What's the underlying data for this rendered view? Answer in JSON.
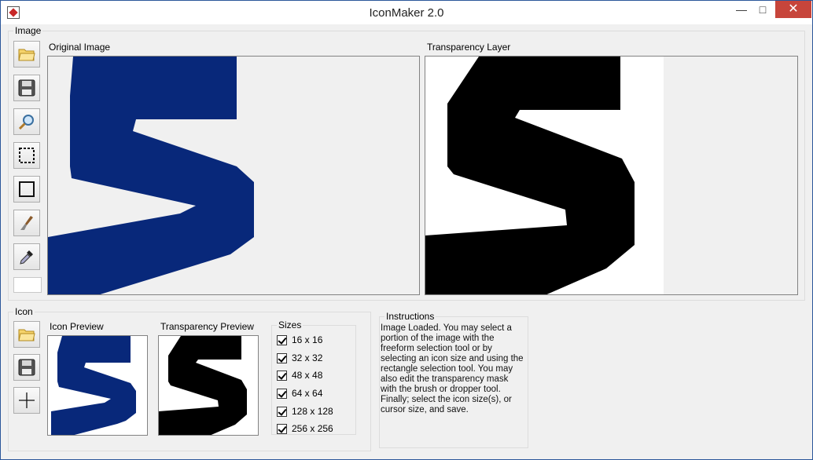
{
  "window": {
    "title": "IconMaker 2.0",
    "close_glyph": "✕",
    "min_glyph": "—",
    "max_glyph": "□"
  },
  "image_group": {
    "label": "Image",
    "tools": [
      "open-folder-icon",
      "save-disk-icon",
      "zoom-icon",
      "select-marquee-icon",
      "rectangle-icon",
      "brush-icon",
      "dropper-icon"
    ],
    "original_label": "Original Image",
    "transparency_label": "Transparency Layer"
  },
  "icon_group": {
    "label": "Icon",
    "tools": [
      "open-folder-icon",
      "save-disk-icon",
      "crosshair-icon"
    ],
    "preview_label": "Icon Preview",
    "transparency_preview_label": "Transparency Preview",
    "sizes_label": "Sizes",
    "sizes": [
      {
        "label": "16 x 16",
        "checked": true
      },
      {
        "label": "32 x 32",
        "checked": true
      },
      {
        "label": "48 x 48",
        "checked": true
      },
      {
        "label": "64 x 64",
        "checked": true
      },
      {
        "label": "128 x 128",
        "checked": true
      },
      {
        "label": "256 x 256",
        "checked": true
      }
    ]
  },
  "instructions": {
    "label": "Instructions",
    "text": "Image Loaded. You may select a portion of the image with the freeform selection tool or by selecting an icon size and using the rectangle selection tool. You may also edit the transparency mask with the brush or dropper tool. Finally; select the icon size(s), or cursor size, and save."
  },
  "colors": {
    "s_blue": "#08287a",
    "mask_black": "#000000",
    "mask_white": "#ffffff",
    "accent": "#2b579a"
  }
}
